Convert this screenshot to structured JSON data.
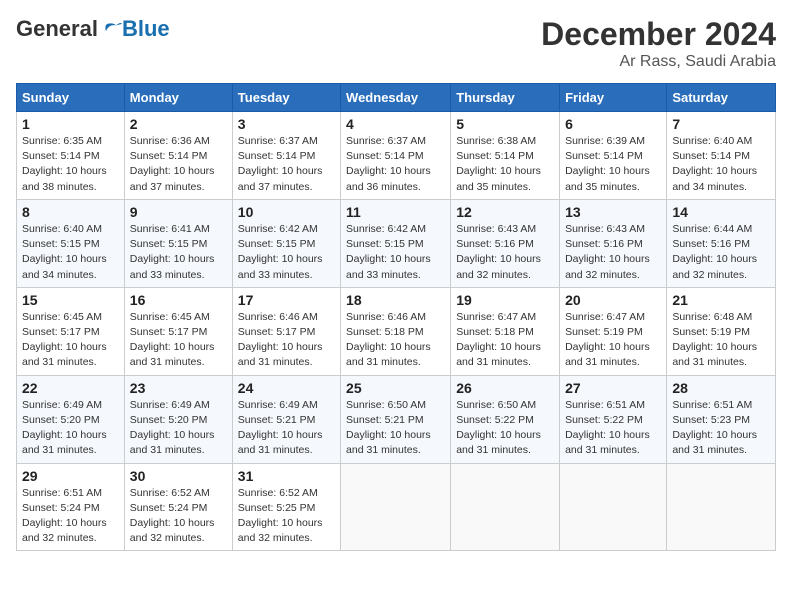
{
  "logo": {
    "general": "General",
    "blue": "Blue"
  },
  "header": {
    "month_year": "December 2024",
    "location": "Ar Rass, Saudi Arabia"
  },
  "weekdays": [
    "Sunday",
    "Monday",
    "Tuesday",
    "Wednesday",
    "Thursday",
    "Friday",
    "Saturday"
  ],
  "weeks": [
    [
      {
        "day": "1",
        "sunrise": "6:35 AM",
        "sunset": "5:14 PM",
        "daylight": "10 hours and 38 minutes."
      },
      {
        "day": "2",
        "sunrise": "6:36 AM",
        "sunset": "5:14 PM",
        "daylight": "10 hours and 37 minutes."
      },
      {
        "day": "3",
        "sunrise": "6:37 AM",
        "sunset": "5:14 PM",
        "daylight": "10 hours and 37 minutes."
      },
      {
        "day": "4",
        "sunrise": "6:37 AM",
        "sunset": "5:14 PM",
        "daylight": "10 hours and 36 minutes."
      },
      {
        "day": "5",
        "sunrise": "6:38 AM",
        "sunset": "5:14 PM",
        "daylight": "10 hours and 35 minutes."
      },
      {
        "day": "6",
        "sunrise": "6:39 AM",
        "sunset": "5:14 PM",
        "daylight": "10 hours and 35 minutes."
      },
      {
        "day": "7",
        "sunrise": "6:40 AM",
        "sunset": "5:14 PM",
        "daylight": "10 hours and 34 minutes."
      }
    ],
    [
      {
        "day": "8",
        "sunrise": "6:40 AM",
        "sunset": "5:15 PM",
        "daylight": "10 hours and 34 minutes."
      },
      {
        "day": "9",
        "sunrise": "6:41 AM",
        "sunset": "5:15 PM",
        "daylight": "10 hours and 33 minutes."
      },
      {
        "day": "10",
        "sunrise": "6:42 AM",
        "sunset": "5:15 PM",
        "daylight": "10 hours and 33 minutes."
      },
      {
        "day": "11",
        "sunrise": "6:42 AM",
        "sunset": "5:15 PM",
        "daylight": "10 hours and 33 minutes."
      },
      {
        "day": "12",
        "sunrise": "6:43 AM",
        "sunset": "5:16 PM",
        "daylight": "10 hours and 32 minutes."
      },
      {
        "day": "13",
        "sunrise": "6:43 AM",
        "sunset": "5:16 PM",
        "daylight": "10 hours and 32 minutes."
      },
      {
        "day": "14",
        "sunrise": "6:44 AM",
        "sunset": "5:16 PM",
        "daylight": "10 hours and 32 minutes."
      }
    ],
    [
      {
        "day": "15",
        "sunrise": "6:45 AM",
        "sunset": "5:17 PM",
        "daylight": "10 hours and 31 minutes."
      },
      {
        "day": "16",
        "sunrise": "6:45 AM",
        "sunset": "5:17 PM",
        "daylight": "10 hours and 31 minutes."
      },
      {
        "day": "17",
        "sunrise": "6:46 AM",
        "sunset": "5:17 PM",
        "daylight": "10 hours and 31 minutes."
      },
      {
        "day": "18",
        "sunrise": "6:46 AM",
        "sunset": "5:18 PM",
        "daylight": "10 hours and 31 minutes."
      },
      {
        "day": "19",
        "sunrise": "6:47 AM",
        "sunset": "5:18 PM",
        "daylight": "10 hours and 31 minutes."
      },
      {
        "day": "20",
        "sunrise": "6:47 AM",
        "sunset": "5:19 PM",
        "daylight": "10 hours and 31 minutes."
      },
      {
        "day": "21",
        "sunrise": "6:48 AM",
        "sunset": "5:19 PM",
        "daylight": "10 hours and 31 minutes."
      }
    ],
    [
      {
        "day": "22",
        "sunrise": "6:49 AM",
        "sunset": "5:20 PM",
        "daylight": "10 hours and 31 minutes."
      },
      {
        "day": "23",
        "sunrise": "6:49 AM",
        "sunset": "5:20 PM",
        "daylight": "10 hours and 31 minutes."
      },
      {
        "day": "24",
        "sunrise": "6:49 AM",
        "sunset": "5:21 PM",
        "daylight": "10 hours and 31 minutes."
      },
      {
        "day": "25",
        "sunrise": "6:50 AM",
        "sunset": "5:21 PM",
        "daylight": "10 hours and 31 minutes."
      },
      {
        "day": "26",
        "sunrise": "6:50 AM",
        "sunset": "5:22 PM",
        "daylight": "10 hours and 31 minutes."
      },
      {
        "day": "27",
        "sunrise": "6:51 AM",
        "sunset": "5:22 PM",
        "daylight": "10 hours and 31 minutes."
      },
      {
        "day": "28",
        "sunrise": "6:51 AM",
        "sunset": "5:23 PM",
        "daylight": "10 hours and 31 minutes."
      }
    ],
    [
      {
        "day": "29",
        "sunrise": "6:51 AM",
        "sunset": "5:24 PM",
        "daylight": "10 hours and 32 minutes."
      },
      {
        "day": "30",
        "sunrise": "6:52 AM",
        "sunset": "5:24 PM",
        "daylight": "10 hours and 32 minutes."
      },
      {
        "day": "31",
        "sunrise": "6:52 AM",
        "sunset": "5:25 PM",
        "daylight": "10 hours and 32 minutes."
      },
      null,
      null,
      null,
      null
    ]
  ]
}
